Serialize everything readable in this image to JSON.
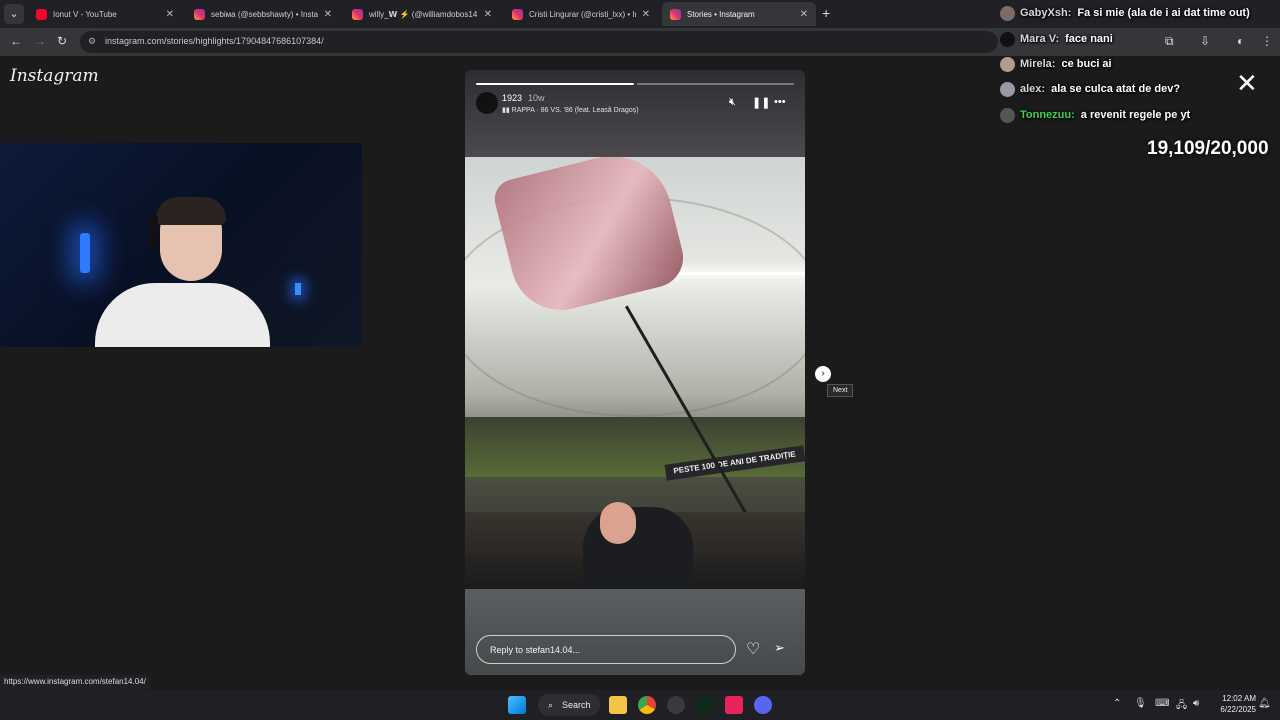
{
  "browser": {
    "tabs": [
      {
        "title": "Ionut V - YouTube",
        "favicon": "youtube-icon",
        "active": false
      },
      {
        "title": "sebiмa (@sebbshawty) • Instag",
        "favicon": "instagram-icon",
        "active": false
      },
      {
        "title": "willy_𝗪 ⚡ (@williamdobos14",
        "favicon": "instagram-icon",
        "active": false
      },
      {
        "title": "Cristi Lingurar (@cristi_lxx) • Ins",
        "favicon": "instagram-icon",
        "active": false
      },
      {
        "title": "Stories • Instagram",
        "favicon": "instagram-icon",
        "active": true
      }
    ],
    "address": "instagram.com/stories/highlights/17904847686107384/",
    "status_url": "https://www.instagram.com/stefan14.04/"
  },
  "page": {
    "logo": "Instagram",
    "story": {
      "username": "1923",
      "age": "10w",
      "song": "RAPPA · 86 VS. '86 (feat. Leasă Dragoș)",
      "progress_segments": 2,
      "current_segment": 1,
      "banner_text": "PESTE 100 DE ANI DE TRADIȚIE",
      "reply_placeholder": "Reply to stefan14.04...",
      "next_tooltip": "Next"
    }
  },
  "overlay": {
    "chat": [
      {
        "user": "GabyXsh:",
        "message": "Fa si mie (ala de i ai dat time out)",
        "color": "#d8d8d8"
      },
      {
        "user": "Mara V:",
        "message": "face nani",
        "color": "#d8d8d8"
      },
      {
        "user": "Mirela:",
        "message": "ce buci ai",
        "color": "#d8d8d8"
      },
      {
        "user": "alex:",
        "message": "ala se culca atat de dev?",
        "color": "#d8d8d8"
      },
      {
        "user": "Tonnezuu:",
        "message": "a revenit regele pe yt",
        "color": "#39d353"
      }
    ],
    "sub_goal": "19,109/20,000"
  },
  "taskbar": {
    "search_label": "Search",
    "time": "12:02 AM",
    "date": "6/22/2025"
  }
}
